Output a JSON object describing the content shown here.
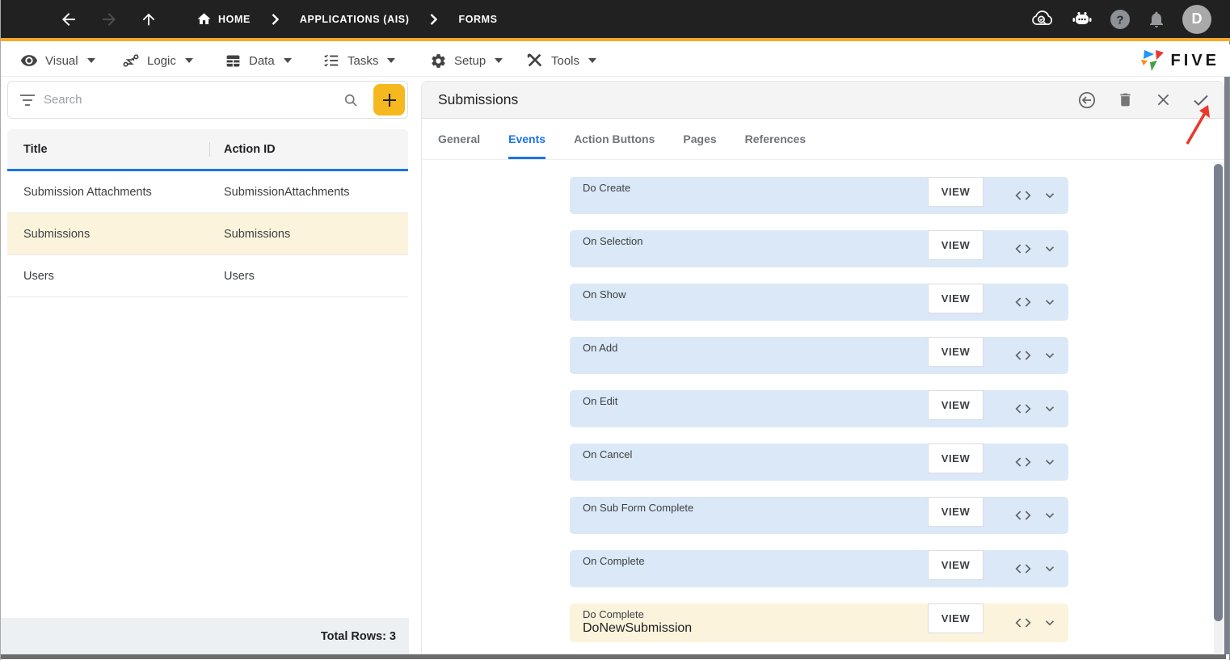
{
  "topbar": {
    "breadcrumb": [
      {
        "label": "HOME",
        "sep": false
      },
      {
        "label": "APPLICATIONS (AIS)",
        "sep": true
      },
      {
        "label": "FORMS",
        "sep": true
      }
    ],
    "avatar_initial": "D",
    "right_icons": [
      "cloud-search-icon",
      "chatbot-icon",
      "help-icon",
      "notifications-icon",
      "avatar"
    ]
  },
  "toolbar": {
    "menus": [
      {
        "label": "Visual",
        "icon": "eye-icon"
      },
      {
        "label": "Logic",
        "icon": "logic-branch-icon"
      },
      {
        "label": "Data",
        "icon": "data-table-icon"
      },
      {
        "label": "Tasks",
        "icon": "tasks-checklist-icon"
      },
      {
        "label": "Setup",
        "icon": "gear-icon"
      },
      {
        "label": "Tools",
        "icon": "tools-icon"
      }
    ],
    "logo_text": "FIVE"
  },
  "left_panel": {
    "search_placeholder": "Search",
    "add_button": "+",
    "table": {
      "columns": [
        "Title",
        "Action ID"
      ],
      "rows": [
        {
          "title": "Submission Attachments",
          "action_id": "SubmissionAttachments",
          "selected": false
        },
        {
          "title": "Submissions",
          "action_id": "Submissions",
          "selected": true
        },
        {
          "title": "Users",
          "action_id": "Users",
          "selected": false
        }
      ],
      "footer": "Total Rows: 3"
    }
  },
  "right_panel": {
    "title": "Submissions",
    "actions": [
      "revert-icon",
      "delete-icon",
      "close-icon",
      "save-icon"
    ],
    "tabs": [
      {
        "label": "General",
        "active": false
      },
      {
        "label": "Events",
        "active": true
      },
      {
        "label": "Action Buttons",
        "active": false
      },
      {
        "label": "Pages",
        "active": false
      },
      {
        "label": "References",
        "active": false
      }
    ],
    "fields": [
      {
        "label": "Do Create",
        "value": "",
        "highlighted": false,
        "view_label": "VIEW"
      },
      {
        "label": "On Selection",
        "value": "",
        "highlighted": false,
        "view_label": "VIEW"
      },
      {
        "label": "On Show",
        "value": "",
        "highlighted": false,
        "view_label": "VIEW"
      },
      {
        "label": "On Add",
        "value": "",
        "highlighted": false,
        "view_label": "VIEW"
      },
      {
        "label": "On Edit",
        "value": "",
        "highlighted": false,
        "view_label": "VIEW"
      },
      {
        "label": "On Cancel",
        "value": "",
        "highlighted": false,
        "view_label": "VIEW"
      },
      {
        "label": "On Sub Form Complete",
        "value": "",
        "highlighted": false,
        "view_label": "VIEW"
      },
      {
        "label": "On Complete",
        "value": "",
        "highlighted": false,
        "view_label": "VIEW"
      },
      {
        "label": "Do Complete",
        "value": "DoNewSubmission",
        "highlighted": true,
        "view_label": "VIEW"
      }
    ]
  },
  "colors": {
    "accent_blue": "#1A73E8",
    "brand_amber": "#F5B81E",
    "topbar_underline": "#F9A826",
    "field_blue": "#DBE8F7",
    "highlight_cream": "#FCF3DC",
    "annotation_red": "#E8392B"
  }
}
